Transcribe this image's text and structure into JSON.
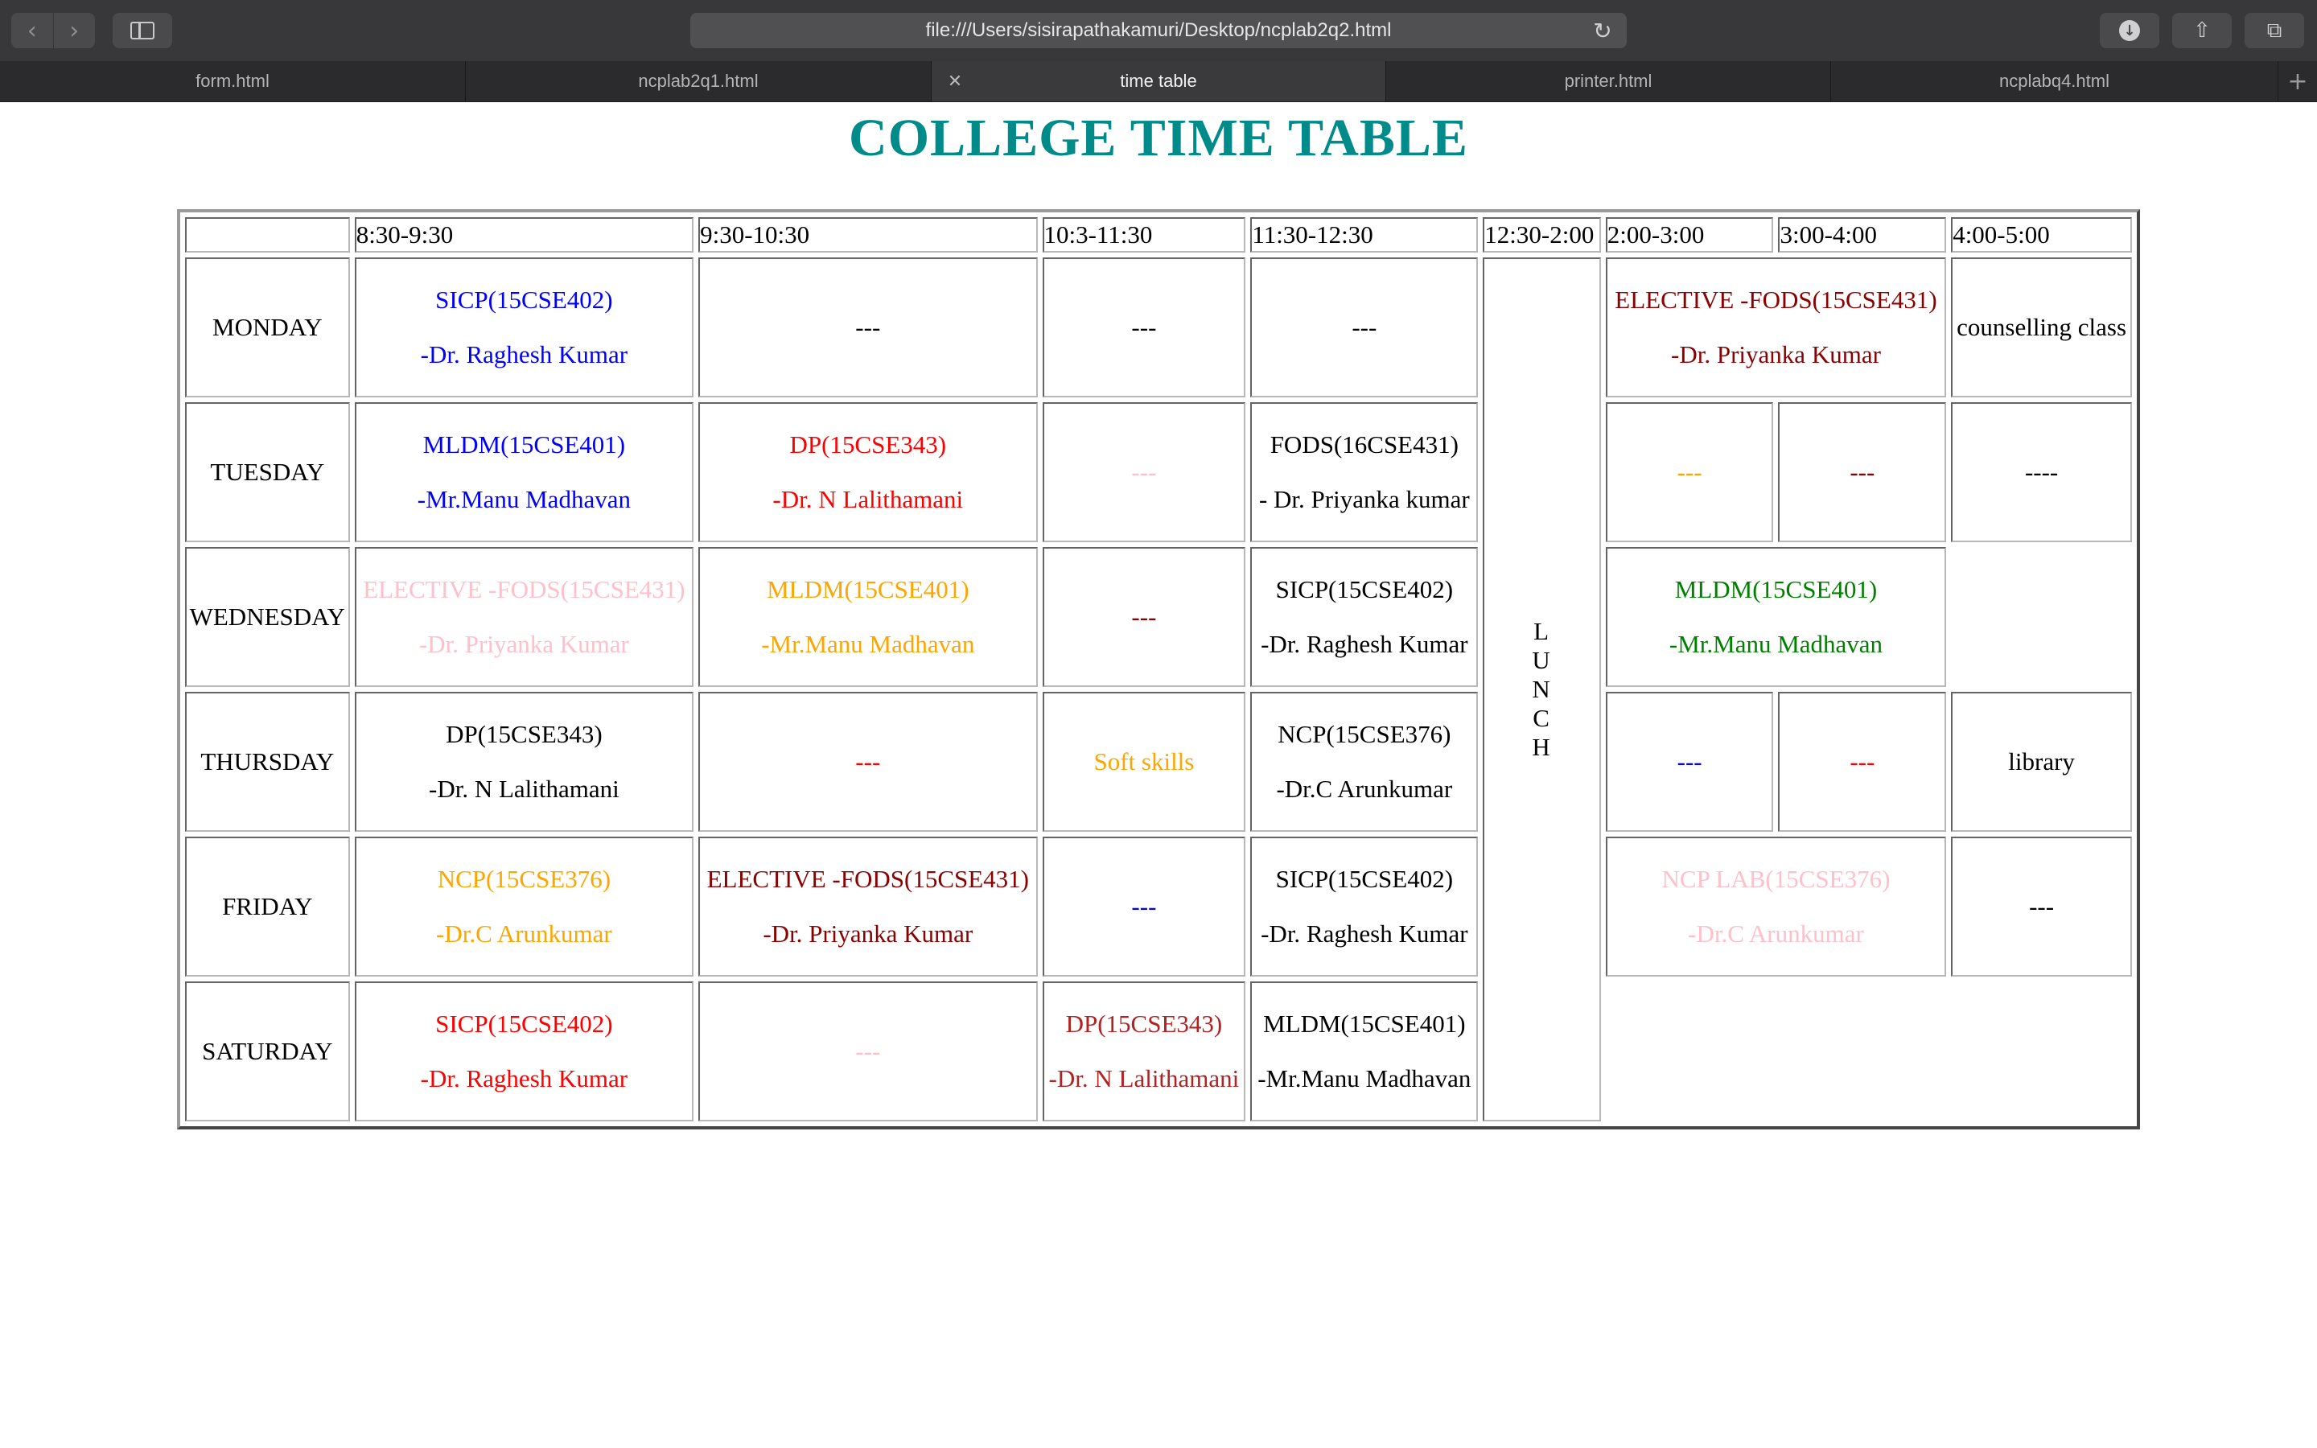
{
  "browser": {
    "url": "file:///Users/sisirapathakamuri/Desktop/ncplab2q2.html",
    "tabs": [
      {
        "label": "form.html",
        "active": false
      },
      {
        "label": "ncplab2q1.html",
        "active": false
      },
      {
        "label": "time table",
        "active": true
      },
      {
        "label": "printer.html",
        "active": false
      },
      {
        "label": "ncplabq4.html",
        "active": false
      }
    ]
  },
  "page": {
    "title": "COLLEGE TIME TABLE",
    "title_color": "#008b8b"
  },
  "timetable": {
    "headers": [
      "",
      "8:30-9:30",
      "9:30-10:30",
      "10:3-11:30",
      "11:30-12:30",
      "12:30-2:00",
      "2:00-3:00",
      "3:00-4:00",
      "4:00-5:00"
    ],
    "lunch_text": "L\nU\nN\nC\nH",
    "days": [
      {
        "day": "MONDAY",
        "slots": [
          {
            "line1": "SICP(15CSE402)",
            "line2": "-Dr. Raghesh Kumar",
            "color": "#0000ff"
          },
          {
            "line1": "---",
            "line2": "",
            "color": "#000000"
          },
          {
            "line1": "---",
            "line2": "",
            "color": "#000000"
          },
          {
            "line1": "---",
            "line2": "",
            "color": "#000000"
          },
          {
            "line1": "ELECTIVE -FODS(15CSE431)",
            "line2": "-Dr. Priyanka Kumar",
            "color": "#8b0000"
          },
          {
            "line1": "counselling class",
            "line2": "",
            "color": "#000000"
          }
        ]
      },
      {
        "day": "TUESDAY",
        "slots": [
          {
            "line1": "MLDM(15CSE401)",
            "line2": "-Mr.Manu Madhavan",
            "color": "#0000ff"
          },
          {
            "line1": "DP(15CSE343)",
            "line2": "-Dr. N Lalithamani",
            "color": "#ff0000"
          },
          {
            "line1": "---",
            "line2": "",
            "color": "#ffc0cb"
          },
          {
            "line1": "FODS(16CSE431)",
            "line2": "- Dr. Priyanka kumar",
            "color": "#000000"
          },
          {
            "line1": "---",
            "line2": "",
            "color": "#ffa500"
          },
          {
            "line1": "---",
            "line2": "",
            "color": "#8b0000"
          },
          {
            "line1": "----",
            "line2": "",
            "color": "#000000"
          }
        ]
      },
      {
        "day": "WEDNESDAY",
        "slots": [
          {
            "line1": "ELECTIVE -FODS(15CSE431)",
            "line2": "-Dr. Priyanka Kumar",
            "color": "#ffc0cb"
          },
          {
            "line1": "MLDM(15CSE401)",
            "line2": "-Mr.Manu Madhavan",
            "color": "#ffa500"
          },
          {
            "line1": "---",
            "line2": "",
            "color": "#8b0000"
          },
          {
            "line1": "SICP(15CSE402)",
            "line2": "-Dr. Raghesh Kumar",
            "color": "#000000"
          },
          {
            "line1": "MLDM(15CSE401)",
            "line2": "-Mr.Manu Madhavan",
            "color": "#008000"
          }
        ]
      },
      {
        "day": "THURSDAY",
        "slots": [
          {
            "line1": "DP(15CSE343)",
            "line2": "-Dr. N Lalithamani",
            "color": "#000000"
          },
          {
            "line1": "---",
            "line2": "",
            "color": "#ff0000"
          },
          {
            "line1": "Soft skills",
            "line2": "",
            "color": "#ffa500"
          },
          {
            "line1": "NCP(15CSE376)",
            "line2": "-Dr.C Arunkumar",
            "color": "#000000"
          },
          {
            "line1": "---",
            "line2": "",
            "color": "#0000ff"
          },
          {
            "line1": "---",
            "line2": "",
            "color": "#ff0000"
          },
          {
            "line1": "library",
            "line2": "",
            "color": "#000000"
          }
        ]
      },
      {
        "day": "FRIDAY",
        "slots": [
          {
            "line1": "NCP(15CSE376)",
            "line2": "-Dr.C Arunkumar",
            "color": "#ffa500"
          },
          {
            "line1": "ELECTIVE -FODS(15CSE431)",
            "line2": "-Dr. Priyanka Kumar",
            "color": "#8b0000"
          },
          {
            "line1": "---",
            "line2": "",
            "color": "#0000ff"
          },
          {
            "line1": "SICP(15CSE402)",
            "line2": "-Dr. Raghesh Kumar",
            "color": "#000000"
          },
          {
            "line1": "NCP LAB(15CSE376)",
            "line2": "-Dr.C Arunkumar",
            "color": "#ffc0cb"
          },
          {
            "line1": "---",
            "line2": "",
            "color": "#000000"
          }
        ]
      },
      {
        "day": "SATURDAY",
        "slots": [
          {
            "line1": "SICP(15CSE402)",
            "line2": "-Dr. Raghesh Kumar",
            "color": "#ff0000"
          },
          {
            "line1": "---",
            "line2": "",
            "color": "#ffc0cb"
          },
          {
            "line1": "DP(15CSE343)",
            "line2": "-Dr. N Lalithamani",
            "color": "#b22222"
          },
          {
            "line1": "MLDM(15CSE401)",
            "line2": "-Mr.Manu Madhavan",
            "color": "#000000"
          }
        ]
      }
    ]
  }
}
